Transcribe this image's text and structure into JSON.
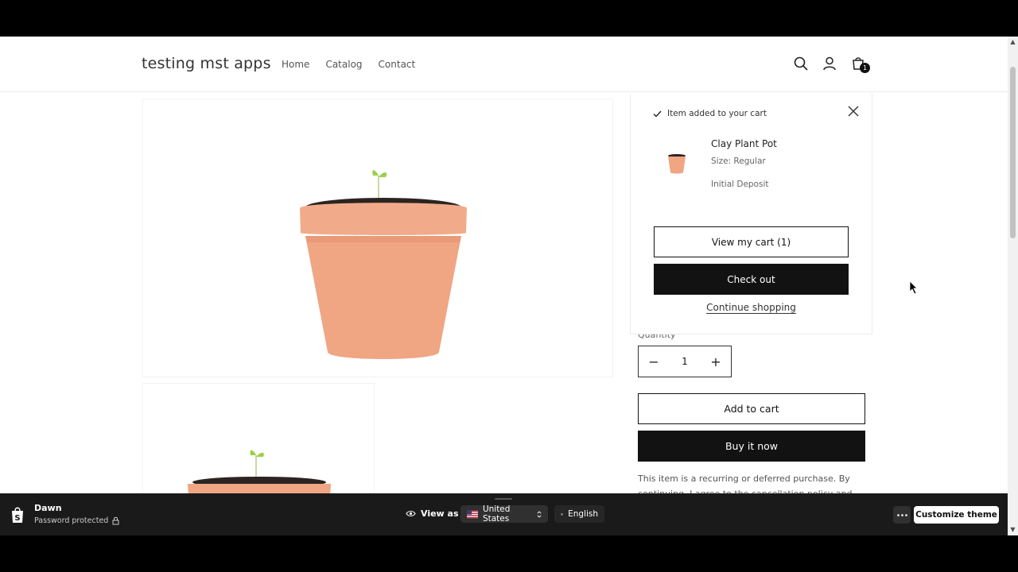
{
  "header": {
    "brand": "testing mst apps",
    "nav": [
      "Home",
      "Catalog",
      "Contact"
    ],
    "cart_count": "1",
    "icons": [
      "search-icon",
      "account-icon",
      "cart-icon"
    ]
  },
  "cart_popup": {
    "added_text": "Item added to your cart",
    "product_name": "Clay Plant Pot",
    "variant": "Size: Regular",
    "plan": "Initial Deposit",
    "view_cart": "View my cart (1)",
    "checkout": "Check out",
    "continue": "Continue shopping"
  },
  "product": {
    "quantity_label": "Quantity",
    "quantity": "1",
    "decrement": "−",
    "increment": "+",
    "add_to_cart": "Add to cart",
    "buy_now": "Buy it now",
    "policy_text": "This item is a recurring or deferred purchase. By continuing, I agree to the cancellation policy and"
  },
  "theme_bar": {
    "theme_name": "Dawn",
    "status": "Password protected",
    "view_as": "View as",
    "country": "United States",
    "language": "English",
    "customize": "Customize theme"
  },
  "colors": {
    "accent": "#121212",
    "pot": "#f0a583",
    "soil": "#2b2420",
    "theme_bar": "#1a1a1a"
  }
}
